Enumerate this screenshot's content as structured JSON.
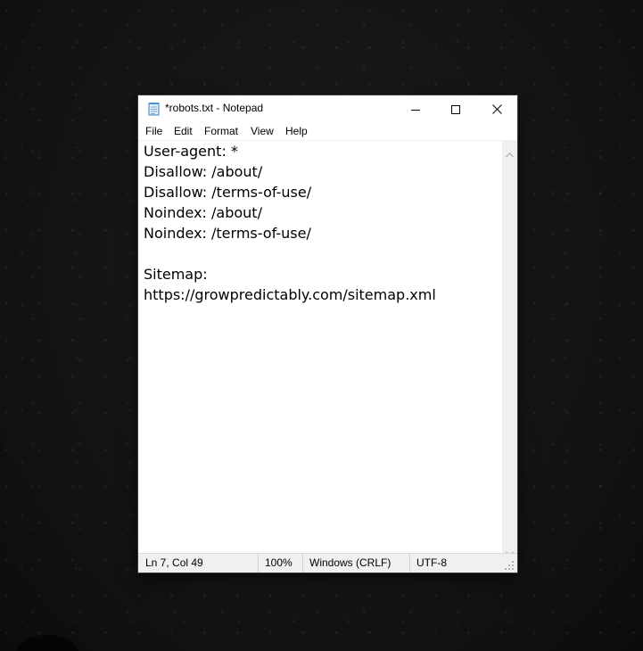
{
  "window": {
    "title": "*robots.txt - Notepad",
    "app_icon": "notepad-icon",
    "controls": {
      "minimize_icon": "minimize-icon",
      "maximize_icon": "maximize-icon",
      "close_icon": "close-icon"
    }
  },
  "menu": {
    "items": [
      {
        "label": "File"
      },
      {
        "label": "Edit"
      },
      {
        "label": "Format"
      },
      {
        "label": "View"
      },
      {
        "label": "Help"
      }
    ]
  },
  "editor": {
    "content": "User-agent: *\nDisallow: /about/\nDisallow: /terms-of-use/\nNoindex: /about/\nNoindex: /terms-of-use/\n\nSitemap:\nhttps://growpredictably.com/sitemap.xml"
  },
  "status": {
    "position": "Ln 7, Col 49",
    "zoom": "100%",
    "line_ending": "Windows (CRLF)",
    "encoding": "UTF-8"
  },
  "colors": {
    "desktop_background": "#141414",
    "window_background": "#ffffff",
    "statusbar_background": "#f0f0f0"
  }
}
